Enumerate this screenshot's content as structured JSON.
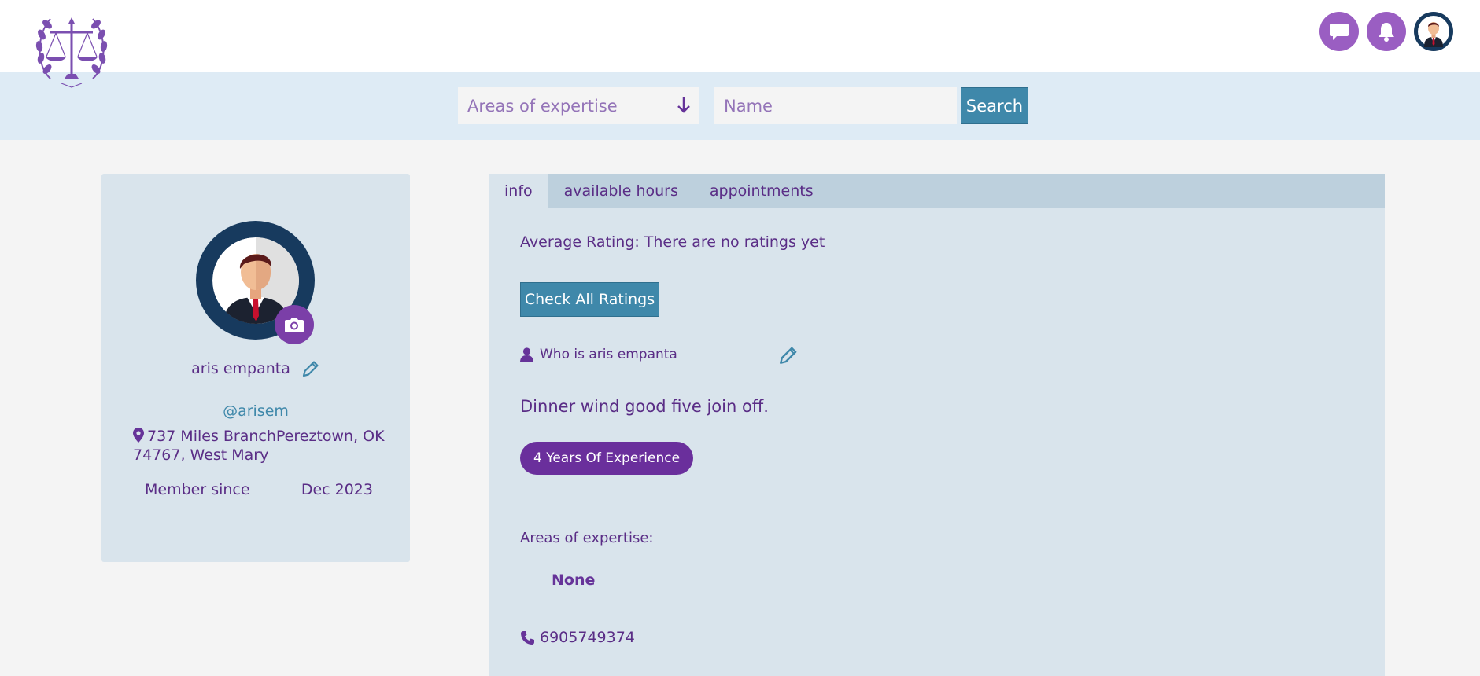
{
  "header": {
    "logo_icon": "scales-of-justice-laurel-logo",
    "messages_icon": "chat-bubble-icon",
    "notifications_icon": "bell-icon",
    "colors": {
      "accent": "#9a5ec2",
      "avatar_bg": "#173a5e"
    }
  },
  "search": {
    "expertise_placeholder": "Areas of expertise",
    "name_placeholder": "Name",
    "button_label": "Search"
  },
  "profile": {
    "name": "aris empanta",
    "username": "@arisem",
    "address": "737 Miles BranchPereztown, OK 74767, West Mary",
    "member_since_label": "Member since",
    "member_since_value": "Dec 2023"
  },
  "tabs": [
    {
      "label": "info",
      "active": true
    },
    {
      "label": "available hours",
      "active": false
    },
    {
      "label": "appointments",
      "active": false
    }
  ],
  "info": {
    "rating_text": "Average Rating: There are no ratings yet",
    "check_ratings_label": "Check All Ratings",
    "who_label": "Who is aris empanta",
    "bio": "Dinner wind good five join off.",
    "experience_badge": "4 Years Of Experience",
    "areas_label": "Areas of expertise:",
    "areas_value": "None",
    "phone": "6905749374"
  }
}
